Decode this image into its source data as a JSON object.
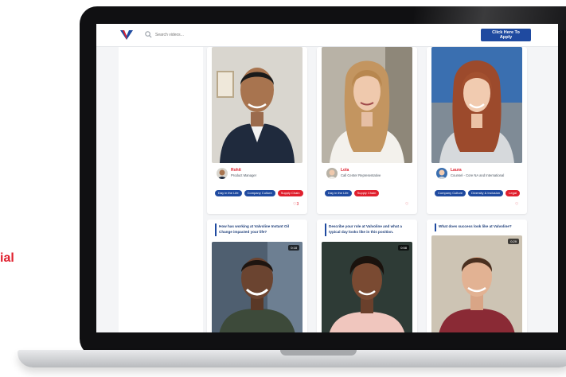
{
  "side_text": "ial",
  "topbar": {
    "search_placeholder": "Search videos...",
    "apply_button": "Click Here To Apply"
  },
  "colors": {
    "brand_blue": "#1f4aa0",
    "brand_red": "#e0202e"
  },
  "profiles": [
    {
      "name": "Rohit",
      "title": "Product Manager",
      "tags": [
        "Day in the Life",
        "Company Culture",
        "Supply Chain"
      ],
      "like_count": "3"
    },
    {
      "name": "Lola",
      "title": "Call Center Representative",
      "tags": [
        "Day in the Life",
        "Supply Chain"
      ]
    },
    {
      "name": "Laura",
      "title": "Counsel - Core NA and International",
      "tags": [
        "Company Culture",
        "Diversity & Inclusion",
        "Legal"
      ]
    }
  ],
  "questions": [
    {
      "text": "How has working at Valvoline Instant Oil Change impacted your life?",
      "duration": "0:18"
    },
    {
      "text": "Describe your role at Valvoline and what a typical day looks like in this position.",
      "duration": "0:58"
    },
    {
      "text": "What does success look like at Valvoline?",
      "duration": "0:29"
    }
  ]
}
